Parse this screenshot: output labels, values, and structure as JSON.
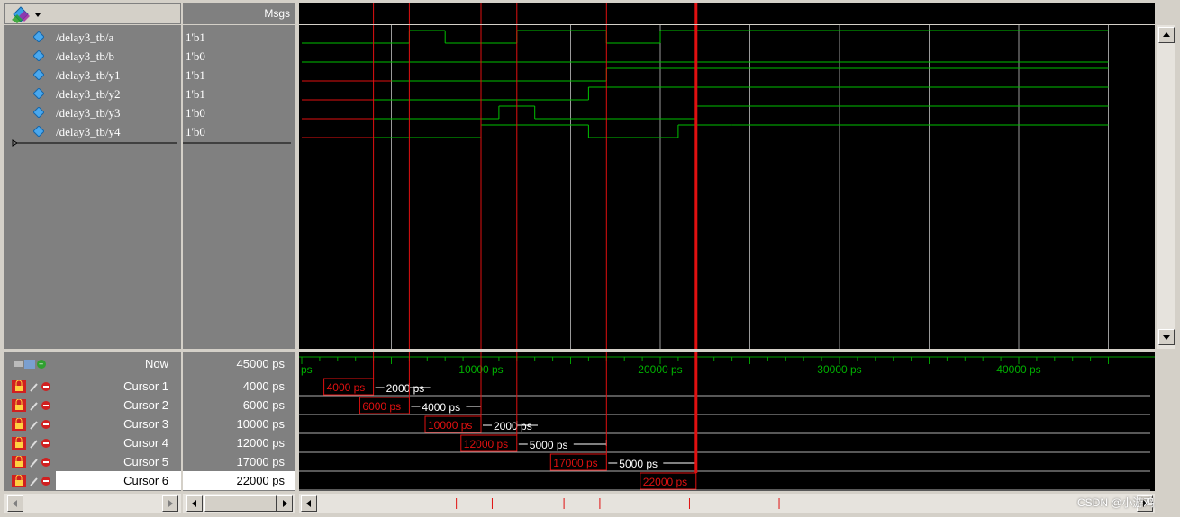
{
  "header": {
    "msgs_label": "Msgs"
  },
  "signals": [
    {
      "name": "/delay3_tb/a",
      "value": "1'b1",
      "icon": "signal-diamond-icon"
    },
    {
      "name": "/delay3_tb/b",
      "value": "1'b0",
      "icon": "signal-diamond-icon"
    },
    {
      "name": "/delay3_tb/y1",
      "value": "1'b1",
      "icon": "signal-diamond-icon"
    },
    {
      "name": "/delay3_tb/y2",
      "value": "1'b1",
      "icon": "signal-diamond-icon"
    },
    {
      "name": "/delay3_tb/y3",
      "value": "1'b0",
      "icon": "signal-diamond-icon"
    },
    {
      "name": "/delay3_tb/y4",
      "value": "1'b0",
      "icon": "signal-diamond-icon"
    }
  ],
  "now": {
    "label": "Now",
    "value": "45000 ps"
  },
  "cursors": [
    {
      "label": "Cursor 1",
      "value": "4000 ps",
      "time": 4000,
      "delta": "2000 ps"
    },
    {
      "label": "Cursor 2",
      "value": "6000 ps",
      "time": 6000,
      "delta": "4000 ps"
    },
    {
      "label": "Cursor 3",
      "value": "10000 ps",
      "time": 10000,
      "delta": "2000 ps"
    },
    {
      "label": "Cursor 4",
      "value": "12000 ps",
      "time": 12000,
      "delta": "5000 ps"
    },
    {
      "label": "Cursor 5",
      "value": "17000 ps",
      "time": 17000,
      "delta": "5000 ps"
    },
    {
      "label": "Cursor 6",
      "value": "22000 ps",
      "time": 22000,
      "delta": ""
    }
  ],
  "active_cursor": 22000,
  "timeline": {
    "start_label": "ps",
    "major_ticks": [
      {
        "time": 10000,
        "label": "10000 ps"
      },
      {
        "time": 20000,
        "label": "20000 ps"
      },
      {
        "time": 30000,
        "label": "30000 ps"
      },
      {
        "time": 40000,
        "label": "40000 ps"
      }
    ]
  },
  "waveforms": {
    "time_range": [
      0,
      45000
    ],
    "gridlines": [
      5000,
      15000,
      20000,
      25000,
      30000,
      35000,
      40000,
      45000
    ],
    "traces": [
      {
        "signal": "/delay3_tb/a",
        "start": 0,
        "end": 45000,
        "segments": [
          [
            0,
            "0"
          ],
          [
            6000,
            "1"
          ],
          [
            8000,
            "0"
          ],
          [
            12000,
            "1"
          ],
          [
            17000,
            "0"
          ],
          [
            20000,
            "1"
          ]
        ]
      },
      {
        "signal": "/delay3_tb/b",
        "start": 0,
        "end": 45000,
        "segments": [
          [
            0,
            "1"
          ],
          [
            0,
            "0"
          ]
        ]
      },
      {
        "signal": "/delay3_tb/y1",
        "start": 0,
        "end": 45000,
        "segments": [
          [
            0,
            "x"
          ],
          [
            5000,
            "0"
          ],
          [
            17000,
            "1"
          ]
        ]
      },
      {
        "signal": "/delay3_tb/y2",
        "start": 0,
        "end": 45000,
        "segments": [
          [
            0,
            "x"
          ],
          [
            4000,
            "0"
          ],
          [
            5000,
            "0"
          ],
          [
            16000,
            "1"
          ]
        ]
      },
      {
        "signal": "/delay3_tb/y3",
        "start": 0,
        "end": 45000,
        "segments": [
          [
            0,
            "x"
          ],
          [
            4000,
            "0"
          ],
          [
            11000,
            "1"
          ],
          [
            13000,
            "0"
          ],
          [
            22000,
            "1"
          ],
          [
            25000,
            "0"
          ],
          [
            25000,
            "1"
          ]
        ]
      },
      {
        "signal": "/delay3_tb/y4",
        "start": 0,
        "end": 45000,
        "segments": [
          [
            0,
            "x"
          ],
          [
            4000,
            "0"
          ],
          [
            10000,
            "1"
          ],
          [
            16000,
            "0"
          ],
          [
            21000,
            "1"
          ],
          [
            24000,
            "0"
          ],
          [
            24000,
            "1"
          ]
        ]
      }
    ]
  },
  "colors": {
    "wave_green": "#00c000",
    "cursor_red": "#e01010",
    "pane_gray": "#808080",
    "bg_black": "#000000"
  },
  "watermark": "CSDN @小游鸡"
}
